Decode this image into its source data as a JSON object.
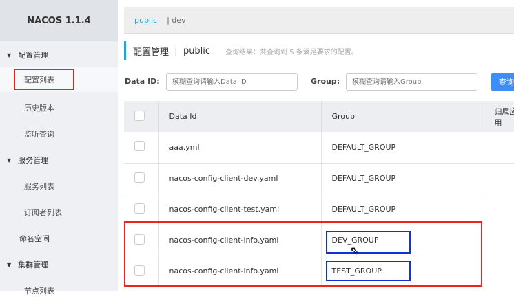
{
  "app": {
    "title": "NACOS 1.1.4"
  },
  "sidebar": {
    "groups": [
      {
        "label": "配置管理",
        "items": [
          "配置列表",
          "历史版本",
          "监听查询"
        ]
      },
      {
        "label": "服务管理",
        "items": [
          "服务列表",
          "订阅者列表"
        ]
      },
      {
        "label": "命名空间"
      },
      {
        "label": "集群管理",
        "items": [
          "节点列表"
        ]
      }
    ]
  },
  "namespaces": {
    "active": "public",
    "other": "dev"
  },
  "page": {
    "title": "配置管理",
    "separator": "|",
    "namespace": "public",
    "result_hint": "查询结果：共查询到 5 条满足要求的配置。"
  },
  "search": {
    "data_id_label": "Data ID:",
    "data_id_placeholder": "模糊查询请输入Data ID",
    "group_label": "Group:",
    "group_placeholder": "模糊查询请输入Group",
    "query_button": "查询"
  },
  "table": {
    "columns": [
      "Data Id",
      "Group",
      "归属应用"
    ],
    "rows": [
      {
        "data_id": "aaa.yml",
        "group": "DEFAULT_GROUP"
      },
      {
        "data_id": "nacos-config-client-dev.yaml",
        "group": "DEFAULT_GROUP"
      },
      {
        "data_id": "nacos-config-client-test.yaml",
        "group": "DEFAULT_GROUP"
      },
      {
        "data_id": "nacos-config-client-info.yaml",
        "group": "DEV_GROUP"
      },
      {
        "data_id": "nacos-config-client-info.yaml",
        "group": "TEST_GROUP"
      }
    ]
  },
  "colors": {
    "accent": "#2aa3dd",
    "button": "#3d8ff5",
    "highlight_red": "#e8261c",
    "highlight_blue": "#1030d8"
  }
}
